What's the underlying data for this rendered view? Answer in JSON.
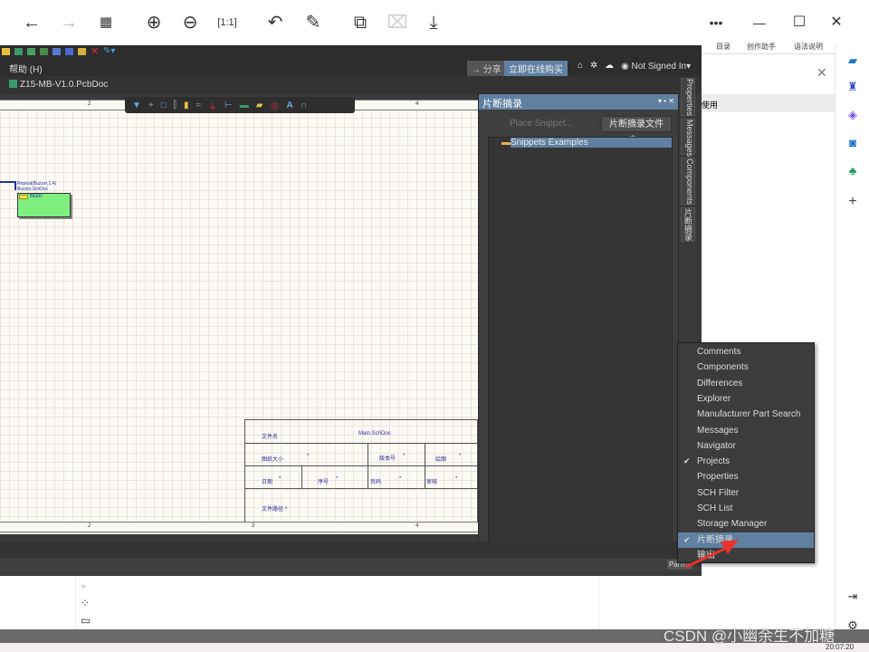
{
  "viewer_toolbar": {
    "icons": [
      "back-icon",
      "forward-icon",
      "grid-icon",
      "zoom-in-icon",
      "zoom-out-icon",
      "actual-size-icon",
      "rotate-icon",
      "edit-icon",
      "extract-icon",
      "disabled-icon",
      "download-icon"
    ],
    "more": "•••",
    "minimize": "—",
    "maximize": "☐",
    "close": "✕"
  },
  "app": {
    "menu": {
      "help": "帮助 (H)",
      "share": "分享",
      "buy": "立即在线购买",
      "user": "Not Signed In"
    },
    "tab": {
      "doc": "Z15-MB-V1.0.PcbDoc"
    },
    "ruler": {
      "top": [
        "2",
        "3",
        "4"
      ],
      "bottom": [
        "2",
        "3",
        "4"
      ]
    },
    "component": {
      "line1": "Repeat(Buzzer,1,4)",
      "line2": "Buzzer.SchDoc",
      "port": "BEED"
    },
    "title_block": {
      "file_name_label": "文件名",
      "file_name": "Main.SchDoc",
      "size_label": "图纸大小",
      "size": "*",
      "version_label": "版本号",
      "version": "*",
      "drawing_label": "绘图",
      "drawing": "*",
      "date_label": "日期",
      "date": "*",
      "seq_label": "序号",
      "seq": "*",
      "page_label": "页码",
      "page": "*",
      "review_label": "审核",
      "review": "*",
      "path_label": "文件路径",
      "path": "*"
    },
    "snippets_panel": {
      "title": "片断摘录",
      "place_button": "Place Snippet...",
      "folder_button": "片断摘录文件夹...",
      "tree_item": "Snippets Examples"
    },
    "side_tabs": [
      "Properties",
      "Messages",
      "Components",
      "片断摘录"
    ],
    "panels_button": "Panels",
    "panels_menu": [
      {
        "label": "Comments",
        "checked": false
      },
      {
        "label": "Components",
        "checked": false
      },
      {
        "label": "Differences",
        "checked": false
      },
      {
        "label": "Explorer",
        "checked": false
      },
      {
        "label": "Manufacturer Part Search",
        "checked": false
      },
      {
        "label": "Messages",
        "checked": false
      },
      {
        "label": "Navigator",
        "checked": false
      },
      {
        "label": "Projects",
        "checked": true
      },
      {
        "label": "Properties",
        "checked": false
      },
      {
        "label": "SCH Filter",
        "checked": false
      },
      {
        "label": "SCH List",
        "checked": false
      },
      {
        "label": "Storage Manager",
        "checked": false
      },
      {
        "label": "片断摘录",
        "checked": true,
        "selected": true
      },
      {
        "label": "输出",
        "checked": false
      }
    ]
  },
  "right_pane": {
    "top_links": [
      "目录",
      "创作助手",
      "语法说明"
    ],
    "close": "✕",
    "row_text": "使用"
  },
  "watermark": "CSDN @小幽余生不加糖",
  "clock": "20:07:20",
  "colors": {
    "panel_header": "#5f80a0",
    "canvas": "#fcfaf5",
    "arrow": "#e8322a"
  }
}
